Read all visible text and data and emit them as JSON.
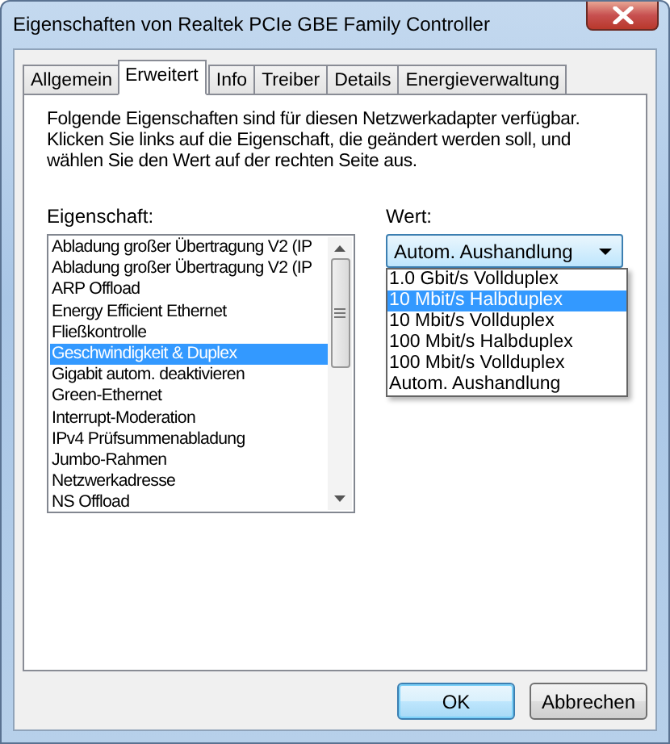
{
  "window": {
    "title": "Eigenschaften von Realtek PCIe GBE Family Controller"
  },
  "tabs": [
    {
      "label": "Allgemein",
      "selected": false
    },
    {
      "label": "Erweitert",
      "selected": true
    },
    {
      "label": "Info",
      "selected": false
    },
    {
      "label": "Treiber",
      "selected": false
    },
    {
      "label": "Details",
      "selected": false
    },
    {
      "label": "Energieverwaltung",
      "selected": false
    }
  ],
  "description": "Folgende Eigenschaften sind für diesen Netzwerkadapter verfügbar. Klicken Sie links auf die Eigenschaft, die geändert werden soll, und wählen Sie den Wert auf der rechten Seite aus.",
  "property_label": "Eigenschaft:",
  "properties": [
    {
      "label": "Abladung großer Übertragung V2 (IP",
      "selected": false
    },
    {
      "label": "Abladung großer Übertragung V2 (IP",
      "selected": false
    },
    {
      "label": "ARP Offload",
      "selected": false
    },
    {
      "label": "Energy Efficient Ethernet",
      "selected": false
    },
    {
      "label": "Fließkontrolle",
      "selected": false
    },
    {
      "label": "Geschwindigkeit & Duplex",
      "selected": true
    },
    {
      "label": "Gigabit autom. deaktivieren",
      "selected": false
    },
    {
      "label": "Green-Ethernet",
      "selected": false
    },
    {
      "label": "Interrupt-Moderation",
      "selected": false
    },
    {
      "label": "IPv4 Prüfsummenabladung",
      "selected": false
    },
    {
      "label": "Jumbo-Rahmen",
      "selected": false
    },
    {
      "label": "Netzwerkadresse",
      "selected": false
    },
    {
      "label": "NS Offload",
      "selected": false
    }
  ],
  "value_label": "Wert:",
  "value_dropdown": {
    "value": "Autom. Aushandlung",
    "expanded": true,
    "options": [
      {
        "label": "1.0 Gbit/s Vollduplex",
        "highlighted": false
      },
      {
        "label": "10 Mbit/s Halbduplex",
        "highlighted": true
      },
      {
        "label": "10 Mbit/s Vollduplex",
        "highlighted": false
      },
      {
        "label": "100 Mbit/s Halbduplex",
        "highlighted": false
      },
      {
        "label": "100 Mbit/s Vollduplex",
        "highlighted": false
      },
      {
        "label": "Autom. Aushandlung",
        "highlighted": false
      }
    ]
  },
  "buttons": [
    {
      "label": "OK",
      "default": true
    },
    {
      "label": "Abbrechen",
      "default": false
    }
  ]
}
